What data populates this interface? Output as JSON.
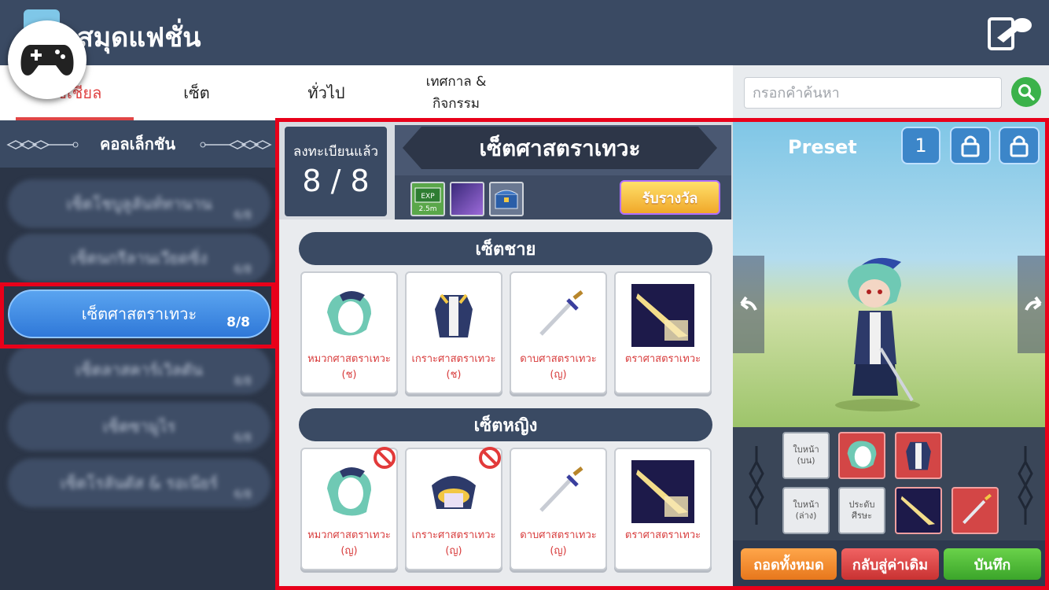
{
  "header": {
    "title": "สมุดแฟชั่น"
  },
  "tabs": [
    {
      "label": "โซเชียล"
    },
    {
      "label": "เซ็ต"
    },
    {
      "label": "ทั่วไป"
    },
    {
      "label": "เทศกาล & กิจกรรม"
    }
  ],
  "search": {
    "placeholder": "กรอกคำค้นหา"
  },
  "sidebar": {
    "title": "คอลเล็กชัน",
    "items": [
      {
        "label": "เซ็ตโชบูลูลันท์ทานาน",
        "count": "6/8"
      },
      {
        "label": "เซ็ตนกรีลานเวียดซิ่ง",
        "count": "6/8"
      },
      {
        "label": "เซ็ตศาสตราเทวะ",
        "count": "8/8"
      },
      {
        "label": "เซ็ตลาสคาร์เวิลตัน",
        "count": "8/8"
      },
      {
        "label": "เซ็ตซามูไร",
        "count": "6/8"
      },
      {
        "label": "เซ็ตโรลันดัส & รอเนียร์",
        "count": "6/8"
      }
    ]
  },
  "register": {
    "label": "ลงทะเบียนแล้ว",
    "count": "8 / 8"
  },
  "set": {
    "title": "เซ็ตศาสตราเทวะ",
    "claim_label": "รับรางวัล",
    "exp_label": "EXP",
    "exp_value": "2.5m"
  },
  "male": {
    "title": "เซ็ตชาย",
    "items": [
      {
        "name": "หมวกศาสตราเทวะ (ช)"
      },
      {
        "name": "เกราะศาสตราเทวะ (ช)"
      },
      {
        "name": "ดาบศาสตราเทวะ (ญ)"
      },
      {
        "name": "ตราศาสตราเทวะ"
      }
    ]
  },
  "female": {
    "title": "เซ็ตหญิง",
    "items": [
      {
        "name": "หมวกศาสตราเทวะ (ญ)"
      },
      {
        "name": "เกราะศาสตราเทวะ (ญ)"
      },
      {
        "name": "ดาบศาสตราเทวะ (ญ)"
      },
      {
        "name": "ตราศาสตราเทวะ"
      }
    ]
  },
  "preview": {
    "preset_label": "Preset",
    "preset_number": "1"
  },
  "equip": {
    "face_upper": "ใบหน้า (บน)",
    "face_lower": "ใบหน้า (ล่าง)",
    "earrings": "ประดับศีรษะ"
  },
  "buttons": {
    "remove_all": "ถอดทั้งหมด",
    "reset": "กลับสู่ค่าเดิม",
    "save": "บันทึก"
  },
  "colors": {
    "highlight": "#e8001a",
    "accent_red": "#d83c3c",
    "save_green": "#3bb24a",
    "orange": "#f08a24"
  }
}
